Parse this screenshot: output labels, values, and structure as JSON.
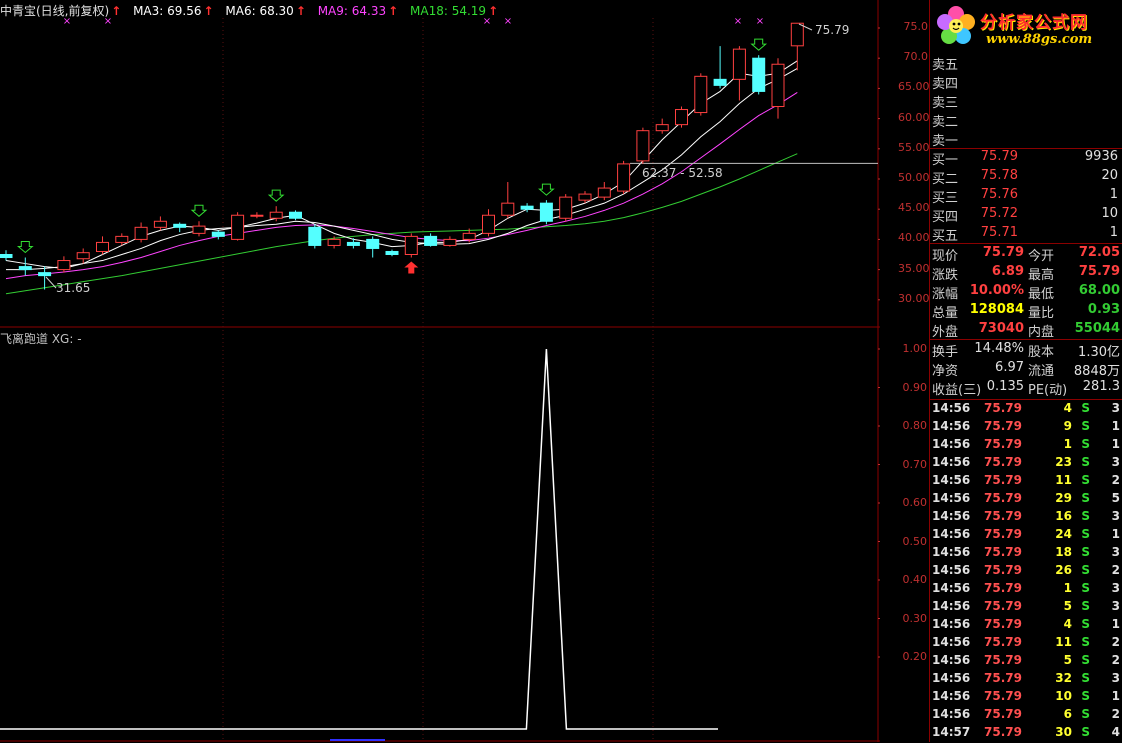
{
  "header": {
    "title": "中青宝(日线,前复权)",
    "ma": [
      {
        "label": "MA3: 69.56",
        "color": "#ffffff"
      },
      {
        "label": "MA6: 68.30",
        "color": "#ffffff"
      },
      {
        "label": "MA9: 64.33",
        "color": "#ff44ff"
      },
      {
        "label": "MA18: 54.19",
        "color": "#33dd33"
      }
    ]
  },
  "annotations": {
    "high_label": "75.79",
    "low_label": "31.65",
    "range_label": "62.37 - 52.58"
  },
  "price_axis": [
    "75.0",
    "70.0",
    "65.00",
    "60.00",
    "55.00",
    "50.00",
    "45.00",
    "40.00",
    "35.00",
    "30.00"
  ],
  "indicator": {
    "header": "飞离跑道 XG: -",
    "axis": [
      "1.00",
      "0.90",
      "0.80",
      "0.70",
      "0.60",
      "0.50",
      "0.40",
      "0.30",
      "0.20"
    ]
  },
  "logo": {
    "brand": "分析家公式网",
    "url": "www.88gs.com"
  },
  "order_book": {
    "sells": [
      {
        "label": "卖五",
        "price": "",
        "vol": ""
      },
      {
        "label": "卖四",
        "price": "",
        "vol": ""
      },
      {
        "label": "卖三",
        "price": "",
        "vol": ""
      },
      {
        "label": "卖二",
        "price": "",
        "vol": ""
      },
      {
        "label": "卖一",
        "price": "",
        "vol": ""
      }
    ],
    "buys": [
      {
        "label": "买一",
        "price": "75.79",
        "vol": "9936"
      },
      {
        "label": "买二",
        "price": "75.78",
        "vol": "20"
      },
      {
        "label": "买三",
        "price": "75.76",
        "vol": "1"
      },
      {
        "label": "买四",
        "price": "75.72",
        "vol": "10"
      },
      {
        "label": "买五",
        "price": "75.71",
        "vol": "1"
      }
    ]
  },
  "quote": [
    {
      "l1": "现价",
      "v1": "75.79",
      "c1": "red",
      "l2": "今开",
      "v2": "72.05",
      "c2": "red"
    },
    {
      "l1": "涨跌",
      "v1": "6.89",
      "c1": "red",
      "l2": "最高",
      "v2": "75.79",
      "c2": "red"
    },
    {
      "l1": "涨幅",
      "v1": "10.00%",
      "c1": "red",
      "l2": "最低",
      "v2": "68.00",
      "c2": "green"
    },
    {
      "l1": "总量",
      "v1": "128084",
      "c1": "yellow",
      "l2": "量比",
      "v2": "0.93",
      "c2": "green"
    },
    {
      "l1": "外盘",
      "v1": "73040",
      "c1": "red",
      "l2": "内盘",
      "v2": "55044",
      "c2": "green"
    }
  ],
  "stats": [
    {
      "l1": "换手",
      "v1": "14.48%",
      "l2": "股本",
      "v2": "1.30亿"
    },
    {
      "l1": "净资",
      "v1": "6.97",
      "l2": "流通",
      "v2": "8848万"
    },
    {
      "l1": "收益(三)",
      "v1": "0.135",
      "l2": "PE(动)",
      "v2": "281.3"
    }
  ],
  "ticks": [
    {
      "time": "14:56",
      "price": "75.79",
      "vol": "4",
      "side": "S",
      "n": "3"
    },
    {
      "time": "14:56",
      "price": "75.79",
      "vol": "9",
      "side": "S",
      "n": "1"
    },
    {
      "time": "14:56",
      "price": "75.79",
      "vol": "1",
      "side": "S",
      "n": "1"
    },
    {
      "time": "14:56",
      "price": "75.79",
      "vol": "23",
      "side": "S",
      "n": "3"
    },
    {
      "time": "14:56",
      "price": "75.79",
      "vol": "11",
      "side": "S",
      "n": "2"
    },
    {
      "time": "14:56",
      "price": "75.79",
      "vol": "29",
      "side": "S",
      "n": "5"
    },
    {
      "time": "14:56",
      "price": "75.79",
      "vol": "16",
      "side": "S",
      "n": "3"
    },
    {
      "time": "14:56",
      "price": "75.79",
      "vol": "24",
      "side": "S",
      "n": "1"
    },
    {
      "time": "14:56",
      "price": "75.79",
      "vol": "18",
      "side": "S",
      "n": "3"
    },
    {
      "time": "14:56",
      "price": "75.79",
      "vol": "26",
      "side": "S",
      "n": "2"
    },
    {
      "time": "14:56",
      "price": "75.79",
      "vol": "1",
      "side": "S",
      "n": "3"
    },
    {
      "time": "14:56",
      "price": "75.79",
      "vol": "5",
      "side": "S",
      "n": "3"
    },
    {
      "time": "14:56",
      "price": "75.79",
      "vol": "4",
      "side": "S",
      "n": "1"
    },
    {
      "time": "14:56",
      "price": "75.79",
      "vol": "11",
      "side": "S",
      "n": "2"
    },
    {
      "time": "14:56",
      "price": "75.79",
      "vol": "5",
      "side": "S",
      "n": "2"
    },
    {
      "time": "14:56",
      "price": "75.79",
      "vol": "32",
      "side": "S",
      "n": "3"
    },
    {
      "time": "14:56",
      "price": "75.79",
      "vol": "10",
      "side": "S",
      "n": "1"
    },
    {
      "time": "14:56",
      "price": "75.79",
      "vol": "6",
      "side": "S",
      "n": "2"
    },
    {
      "time": "14:57",
      "price": "75.79",
      "vol": "30",
      "side": "S",
      "n": "4"
    }
  ],
  "colors": {
    "up": "#ff4040",
    "down": "#54ffff",
    "ma_fast": "#ffffff",
    "ma9": "#ff44ff",
    "ma18": "#33cc33",
    "border": "#8b0000"
  },
  "chart_data": {
    "type": "candlestick",
    "title": "中青宝(日线,前复权)",
    "ylim": [
      28,
      77
    ],
    "candles": [
      {
        "o": 37.5,
        "c": 37.0,
        "h": 38.2,
        "l": 36.5
      },
      {
        "o": 35.5,
        "c": 35.0,
        "h": 37.0,
        "l": 34.0
      },
      {
        "o": 34.5,
        "c": 34.0,
        "h": 35.5,
        "l": 31.7
      },
      {
        "o": 35.0,
        "c": 36.5,
        "h": 37.2,
        "l": 34.5
      },
      {
        "o": 36.8,
        "c": 37.8,
        "h": 38.5,
        "l": 36.0
      },
      {
        "o": 38.0,
        "c": 39.5,
        "h": 40.5,
        "l": 37.5
      },
      {
        "o": 39.5,
        "c": 40.5,
        "h": 41.0,
        "l": 39.0
      },
      {
        "o": 40.0,
        "c": 42.0,
        "h": 42.8,
        "l": 39.5
      },
      {
        "o": 42.0,
        "c": 43.0,
        "h": 43.8,
        "l": 41.5
      },
      {
        "o": 42.5,
        "c": 42.0,
        "h": 42.8,
        "l": 41.2
      },
      {
        "o": 41.0,
        "c": 42.2,
        "h": 43.0,
        "l": 40.5
      },
      {
        "o": 41.2,
        "c": 40.5,
        "h": 41.5,
        "l": 40.0
      },
      {
        "o": 40.0,
        "c": 44.0,
        "h": 44.5,
        "l": 39.8
      },
      {
        "o": 44.0,
        "c": 44.0,
        "h": 44.5,
        "l": 43.5
      },
      {
        "o": 43.5,
        "c": 44.5,
        "h": 45.5,
        "l": 43.0
      },
      {
        "o": 44.5,
        "c": 43.5,
        "h": 44.8,
        "l": 43.2
      },
      {
        "o": 42.0,
        "c": 39.0,
        "h": 42.5,
        "l": 38.5
      },
      {
        "o": 39.0,
        "c": 40.0,
        "h": 40.5,
        "l": 38.5
      },
      {
        "o": 39.5,
        "c": 39.0,
        "h": 40.2,
        "l": 38.5
      },
      {
        "o": 40.0,
        "c": 38.5,
        "h": 40.5,
        "l": 37.0
      },
      {
        "o": 38.0,
        "c": 37.5,
        "h": 38.3,
        "l": 37.2
      },
      {
        "o": 37.5,
        "c": 40.5,
        "h": 41.0,
        "l": 37.0
      },
      {
        "o": 40.5,
        "c": 39.0,
        "h": 41.0,
        "l": 38.8
      },
      {
        "o": 39.0,
        "c": 40.0,
        "h": 40.5,
        "l": 38.8
      },
      {
        "o": 40.0,
        "c": 41.0,
        "h": 41.8,
        "l": 39.5
      },
      {
        "o": 41.0,
        "c": 44.0,
        "h": 45.0,
        "l": 40.5
      },
      {
        "o": 44.0,
        "c": 46.0,
        "h": 49.5,
        "l": 43.5
      },
      {
        "o": 45.5,
        "c": 45.0,
        "h": 46.0,
        "l": 44.5
      },
      {
        "o": 46.0,
        "c": 43.0,
        "h": 46.5,
        "l": 42.5
      },
      {
        "o": 43.5,
        "c": 47.0,
        "h": 47.5,
        "l": 43.0
      },
      {
        "o": 46.5,
        "c": 47.5,
        "h": 48.0,
        "l": 46.0
      },
      {
        "o": 47.0,
        "c": 48.5,
        "h": 49.5,
        "l": 46.5
      },
      {
        "o": 48.0,
        "c": 52.5,
        "h": 53.0,
        "l": 47.5
      },
      {
        "o": 53.0,
        "c": 58.0,
        "h": 58.5,
        "l": 52.5
      },
      {
        "o": 58.0,
        "c": 59.0,
        "h": 60.0,
        "l": 57.5
      },
      {
        "o": 59.0,
        "c": 61.5,
        "h": 62.0,
        "l": 58.5
      },
      {
        "o": 61.0,
        "c": 67.0,
        "h": 67.5,
        "l": 60.5
      },
      {
        "o": 66.5,
        "c": 65.5,
        "h": 72.0,
        "l": 65.0
      },
      {
        "o": 66.5,
        "c": 71.5,
        "h": 72.0,
        "l": 63.0
      },
      {
        "o": 70.0,
        "c": 64.5,
        "h": 70.5,
        "l": 64.0
      },
      {
        "o": 62.0,
        "c": 69.0,
        "h": 70.0,
        "l": 60.0
      },
      {
        "o": 72.05,
        "c": 75.79,
        "h": 75.79,
        "l": 68.0
      }
    ],
    "ma3": [
      36.5,
      36,
      35.5,
      35.2,
      36,
      37.5,
      39,
      40.5,
      41.5,
      42.2,
      42,
      41.5,
      42,
      42.7,
      43.5,
      44,
      42.5,
      41,
      40,
      39.5,
      38.8,
      39,
      39.5,
      39.5,
      40,
      41.5,
      43.5,
      45,
      44.8,
      45,
      46,
      47.5,
      49.5,
      53,
      56.5,
      59.5,
      62.5,
      64.5,
      67.5,
      67,
      67.5,
      69.56
    ],
    "ma6": [
      35,
      35,
      35.2,
      35.5,
      36,
      36.5,
      37.5,
      38.5,
      39.8,
      40.8,
      41.5,
      41.8,
      42,
      42.3,
      42.5,
      43,
      42.8,
      42.2,
      41.5,
      40.8,
      40,
      39.5,
      39.3,
      39.2,
      39.3,
      40,
      41,
      42.3,
      43.3,
      44,
      45,
      46,
      47.5,
      49.5,
      51.5,
      54,
      57,
      59.5,
      62.5,
      65,
      66.5,
      68.3
    ],
    "ma9": [
      33.5,
      34,
      34.3,
      34.6,
      35,
      35.5,
      36.2,
      37,
      38,
      39,
      39.8,
      40.5,
      41,
      41.5,
      42,
      42.3,
      42.4,
      42.2,
      41.8,
      41.3,
      40.8,
      40.3,
      40,
      39.8,
      39.8,
      40.2,
      40.8,
      41.5,
      42.3,
      43,
      43.8,
      44.8,
      46,
      47.5,
      49.2,
      51.2,
      53.5,
      55.8,
      58.2,
      60.5,
      62.3,
      64.33
    ],
    "ma18": [
      31,
      31.5,
      32,
      32.5,
      33,
      33.5,
      34,
      34.6,
      35.2,
      35.8,
      36.4,
      37,
      37.6,
      38.2,
      38.8,
      39.3,
      39.8,
      40.2,
      40.5,
      40.8,
      41,
      41.2,
      41.3,
      41.4,
      41.5,
      41.6,
      41.7,
      41.9,
      42.1,
      42.3,
      42.6,
      43,
      43.6,
      44.4,
      45.3,
      46.3,
      47.5,
      48.7,
      50,
      51.4,
      52.8,
      54.19
    ],
    "xg_spike_index": 28,
    "xg_values": {
      "min": 0,
      "max": 1
    }
  }
}
